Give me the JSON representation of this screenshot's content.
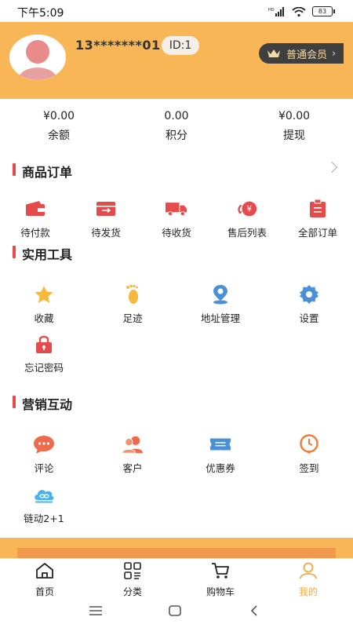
{
  "status_bar": {
    "time": "下午5:09",
    "battery": "83"
  },
  "profile": {
    "phone": "13*******01",
    "id_label": "ID:1",
    "member_label": "普通会员"
  },
  "stats": [
    {
      "value": "¥0.00",
      "label": "余额"
    },
    {
      "value": "0.00",
      "label": "积分"
    },
    {
      "value": "¥0.00",
      "label": "提现"
    }
  ],
  "orders": {
    "title": "商品订单",
    "items": [
      {
        "label": "待付款",
        "icon": "wallet-icon"
      },
      {
        "label": "待发货",
        "icon": "box-icon"
      },
      {
        "label": "待收货",
        "icon": "truck-icon"
      },
      {
        "label": "售后列表",
        "icon": "refund-icon"
      },
      {
        "label": "全部订单",
        "icon": "clipboard-icon"
      }
    ]
  },
  "tools": {
    "title": "实用工具",
    "items": [
      {
        "label": "收藏",
        "icon": "star-icon"
      },
      {
        "label": "足迹",
        "icon": "footprint-icon"
      },
      {
        "label": "地址管理",
        "icon": "location-icon"
      },
      {
        "label": "设置",
        "icon": "gear-icon"
      },
      {
        "label": "忘记密码",
        "icon": "lock-icon"
      }
    ]
  },
  "marketing": {
    "title": "营销互动",
    "items": [
      {
        "label": "评论",
        "icon": "comment-icon"
      },
      {
        "label": "客户",
        "icon": "customers-icon"
      },
      {
        "label": "优惠券",
        "icon": "coupon-icon"
      },
      {
        "label": "签到",
        "icon": "clock-icon"
      },
      {
        "label": "链动2+1",
        "icon": "cloud-link-icon"
      }
    ]
  },
  "tabbar": [
    {
      "label": "首页",
      "icon": "home-icon"
    },
    {
      "label": "分类",
      "icon": "category-icon"
    },
    {
      "label": "购物车",
      "icon": "cart-icon"
    },
    {
      "label": "我的",
      "icon": "user-icon",
      "active": true
    }
  ],
  "colors": {
    "header": "#f9b657",
    "accent": "#e54b4b",
    "active_tab": "#f5a83e"
  }
}
